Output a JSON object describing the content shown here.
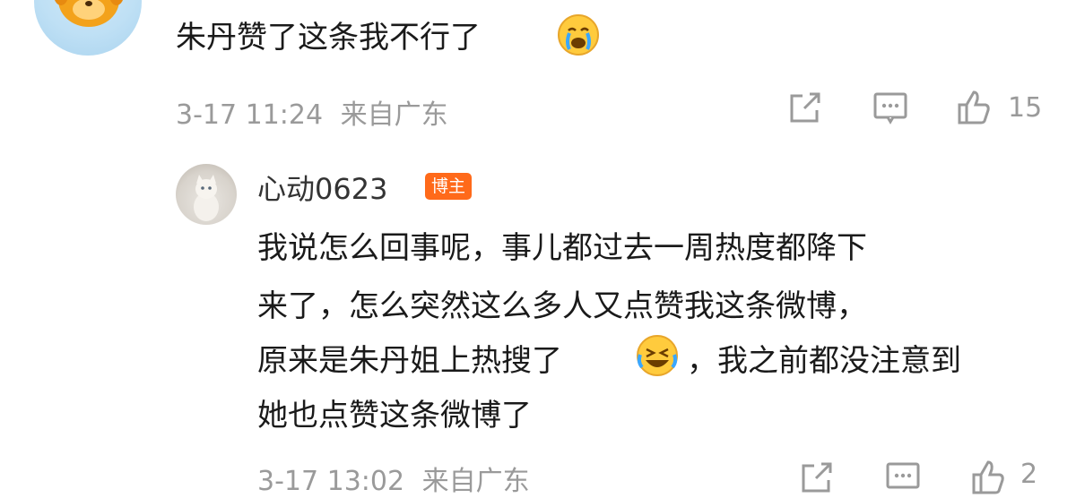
{
  "comment": {
    "text": "朱丹赞了这条我不行了",
    "emoji": "crying-face-emoji",
    "time": "3-17 11:24",
    "location": "来自广东",
    "like_count": "15"
  },
  "reply": {
    "username": "心动0623",
    "badge": "博主",
    "lines": [
      "我说怎么回事呢，事儿都过去一周热度都降下",
      "来了，怎么突然这么多人又点赞我这条微博，",
      "原来是朱丹姐上热搜了",
      "，我之前都没注意到",
      "她也点赞这条微博了"
    ],
    "emoji": "laughing-tears-emoji",
    "time": "3-17 13:02",
    "location": "来自广东",
    "like_count": "2"
  },
  "icons": {
    "share": "share-icon",
    "comment": "comment-icon",
    "like": "thumbs-up-icon"
  },
  "colors": {
    "badge_bg": "#ff6a1a",
    "meta_text": "#9a9a9a",
    "body_text": "#1a1a1a"
  }
}
